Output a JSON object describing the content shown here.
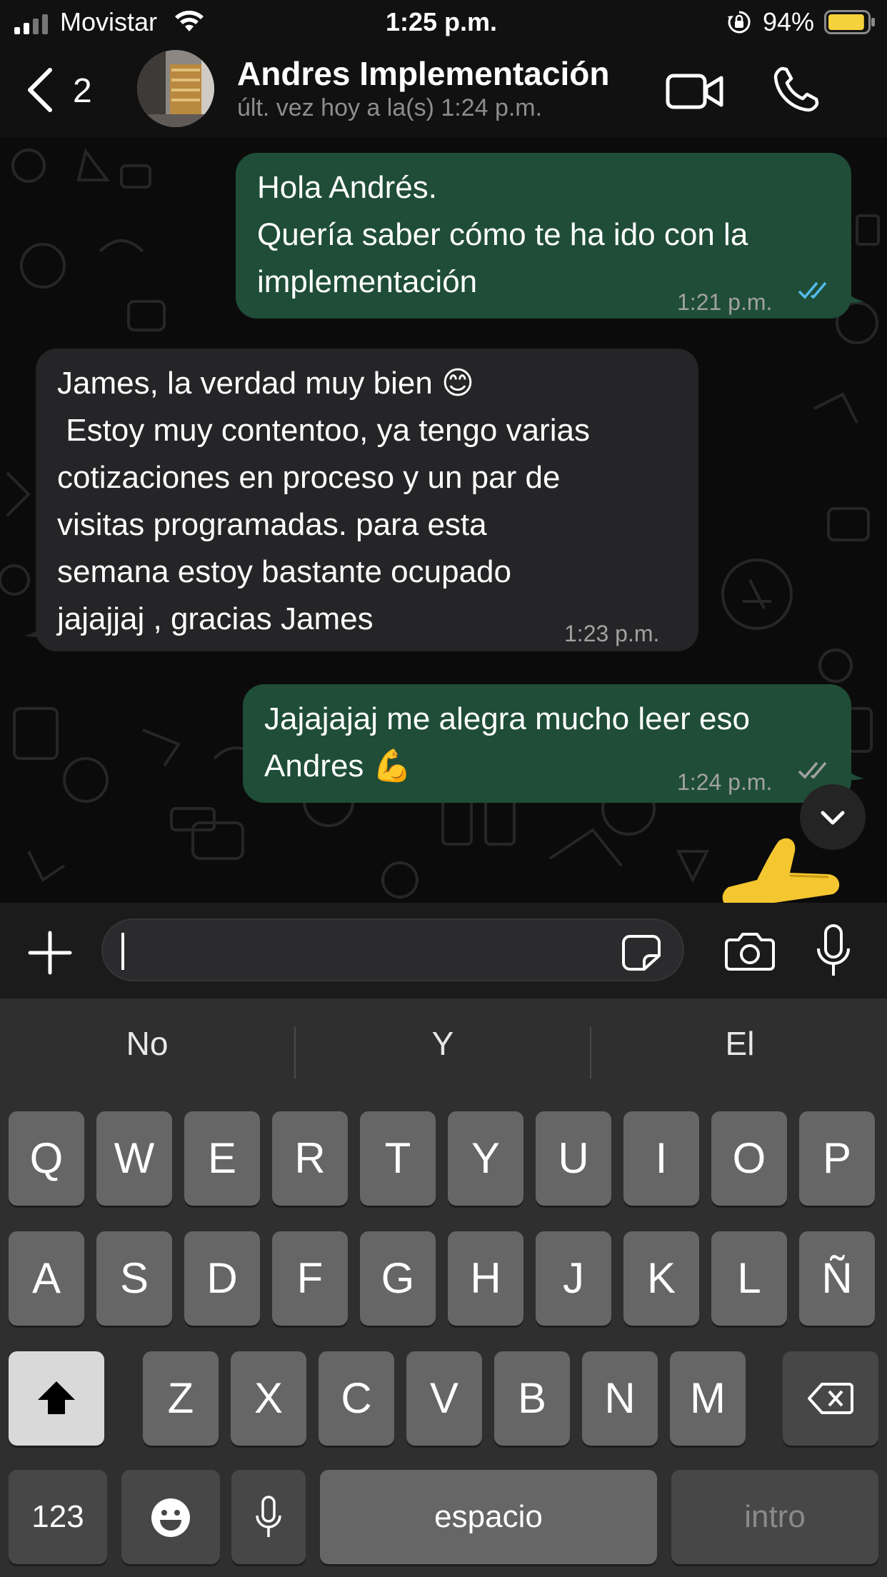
{
  "status_bar": {
    "carrier": "Movistar",
    "time": "1:25 p.m.",
    "battery_percent": "94%",
    "battery_level": 0.94,
    "icons": [
      "signal-icon",
      "wifi-icon",
      "orientation-lock-icon",
      "battery-icon"
    ]
  },
  "header": {
    "back_count": "2",
    "contact_name": "Andres Implementación",
    "contact_status": "últ. vez hoy a la(s) 1:24 p.m.",
    "icons": [
      "back-chevron-icon",
      "video-call-icon",
      "phone-call-icon"
    ]
  },
  "messages": [
    {
      "direction": "outgoing",
      "text": "Hola Andrés.\nQuería saber cómo te ha ido con la\nimplementación",
      "time": "1:21 p.m.",
      "status": "read"
    },
    {
      "direction": "incoming",
      "text": "James, la verdad muy bien 😊\n Estoy muy contentoo, ya tengo varias\ncotizaciones en proceso y un par de\nvisitas programadas. para esta\nsemana estoy bastante ocupado\njajajjaj , gracias James",
      "time": "1:23 p.m."
    },
    {
      "direction": "outgoing",
      "text": "Jajajajaj me alegra mucho leer eso\nAndres 💪",
      "time": "1:24 p.m.",
      "status": "delivered"
    },
    {
      "direction": "outgoing",
      "text": "👍",
      "kind": "emoji"
    }
  ],
  "colors": {
    "outgoing_bubble": "#1f4d38",
    "incoming_bubble": "#252527",
    "read_ticks": "#53bdeb",
    "battery": "#f5d23c"
  },
  "composer": {
    "icons": [
      "plus-icon",
      "sticker-icon",
      "camera-icon",
      "microphone-icon"
    ]
  },
  "keyboard": {
    "suggestions": [
      "No",
      "Y",
      "El"
    ],
    "row1": [
      "Q",
      "W",
      "E",
      "R",
      "T",
      "Y",
      "U",
      "I",
      "O",
      "P"
    ],
    "row2": [
      "A",
      "S",
      "D",
      "F",
      "G",
      "H",
      "J",
      "K",
      "L",
      "Ñ"
    ],
    "row3": [
      "Z",
      "X",
      "C",
      "V",
      "B",
      "N",
      "M"
    ],
    "numbers_key": "123",
    "space_key": "espacio",
    "return_key": "intro"
  }
}
